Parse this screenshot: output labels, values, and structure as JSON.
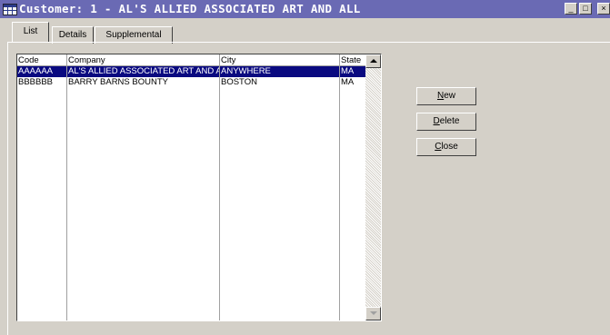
{
  "window": {
    "title": "Customer: 1  -  AL'S ALLIED ASSOCIATED ART AND ALL",
    "minimize_glyph": "_",
    "maximize_glyph": "□",
    "close_glyph": "×",
    "titlebar_color": "#6a6ab4"
  },
  "tabs": [
    {
      "label": "List",
      "active": true
    },
    {
      "label": "Details",
      "active": false
    },
    {
      "label": "Supplemental",
      "active": false
    }
  ],
  "grid": {
    "columns": [
      "Code",
      "Company",
      "City",
      "State"
    ],
    "rows": [
      {
        "code": "AAAAAA",
        "company": "AL'S ALLIED ASSOCIATED ART AND ALL",
        "city": "ANYWHERE",
        "state": "MA",
        "selected": true
      },
      {
        "code": "BBBBBB",
        "company": "BARRY BARNS BOUNTY",
        "city": "BOSTON",
        "state": "MA",
        "selected": false
      }
    ],
    "selection_color": "#0a0a80"
  },
  "buttons": {
    "new": {
      "mnemonic": "N",
      "rest": "ew"
    },
    "delete": {
      "mnemonic": "D",
      "rest": "elete"
    },
    "close": {
      "mnemonic": "C",
      "rest": "lose"
    }
  },
  "icons": {
    "app": "grid-window-icon",
    "scroll_up": "triangle-up",
    "scroll_down": "triangle-down"
  }
}
